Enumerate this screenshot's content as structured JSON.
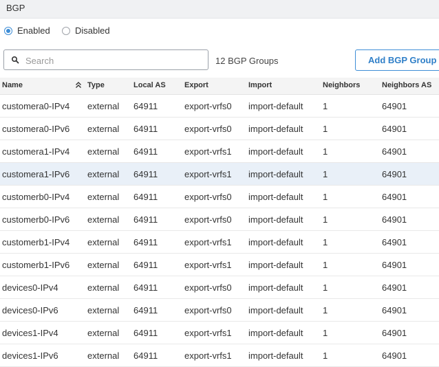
{
  "header": {
    "title": "BGP"
  },
  "status": {
    "options": [
      {
        "label": "Enabled",
        "checked": true
      },
      {
        "label": "Disabled",
        "checked": false
      }
    ]
  },
  "search": {
    "placeholder": "Search",
    "value": ""
  },
  "group_count": "12 BGP Groups",
  "add_button": "Add BGP Group",
  "colors": {
    "accent": "#3d8dd6",
    "highlight_row": "#e9f0f8",
    "header_bg": "#f0f1f3"
  },
  "icons": {
    "search": "search-icon",
    "sort": "sort-ascending-icon"
  },
  "table": {
    "columns": [
      "Name",
      "Type",
      "Local AS",
      "Export",
      "Import",
      "Neighbors",
      "Neighbors AS"
    ],
    "sorted_column": "Name",
    "highlighted_row": 3,
    "rows": [
      [
        "customera0-IPv4",
        "external",
        "64911",
        "export-vrfs0",
        "import-default",
        "1",
        "64901"
      ],
      [
        "customera0-IPv6",
        "external",
        "64911",
        "export-vrfs0",
        "import-default",
        "1",
        "64901"
      ],
      [
        "customera1-IPv4",
        "external",
        "64911",
        "export-vrfs1",
        "import-default",
        "1",
        "64901"
      ],
      [
        "customera1-IPv6",
        "external",
        "64911",
        "export-vrfs1",
        "import-default",
        "1",
        "64901"
      ],
      [
        "customerb0-IPv4",
        "external",
        "64911",
        "export-vrfs0",
        "import-default",
        "1",
        "64901"
      ],
      [
        "customerb0-IPv6",
        "external",
        "64911",
        "export-vrfs0",
        "import-default",
        "1",
        "64901"
      ],
      [
        "customerb1-IPv4",
        "external",
        "64911",
        "export-vrfs1",
        "import-default",
        "1",
        "64901"
      ],
      [
        "customerb1-IPv6",
        "external",
        "64911",
        "export-vrfs1",
        "import-default",
        "1",
        "64901"
      ],
      [
        "devices0-IPv4",
        "external",
        "64911",
        "export-vrfs0",
        "import-default",
        "1",
        "64901"
      ],
      [
        "devices0-IPv6",
        "external",
        "64911",
        "export-vrfs0",
        "import-default",
        "1",
        "64901"
      ],
      [
        "devices1-IPv4",
        "external",
        "64911",
        "export-vrfs1",
        "import-default",
        "1",
        "64901"
      ],
      [
        "devices1-IPv6",
        "external",
        "64911",
        "export-vrfs1",
        "import-default",
        "1",
        "64901"
      ]
    ]
  }
}
